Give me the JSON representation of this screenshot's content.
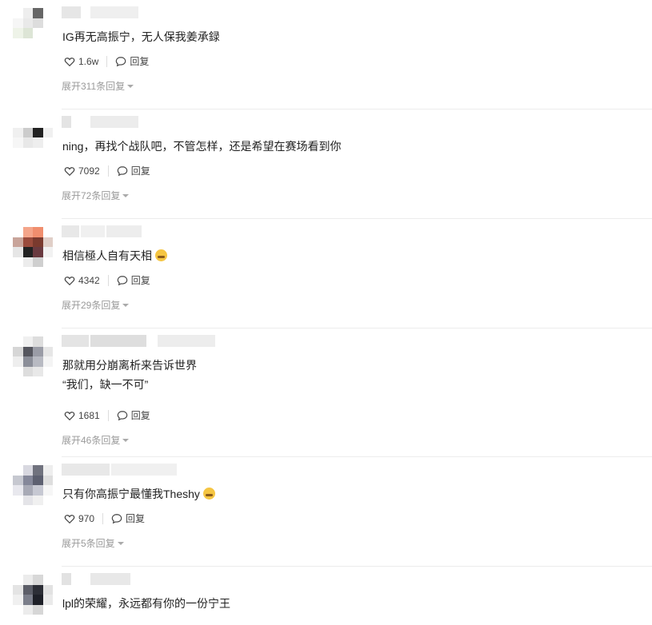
{
  "comments": [
    {
      "text": "IG再无高振宁，无人保我姜承録",
      "likes": "1.6w",
      "reply_label": "回复",
      "expand": "展开311条回复"
    },
    {
      "text": "ning，再找个战队吧，不管怎样，还是希望在赛场看到你",
      "likes": "7092",
      "reply_label": "回复",
      "expand": "展开72条回复"
    },
    {
      "text": "相信極人自有天相",
      "emoji": "crying-face-emoji",
      "likes": "4342",
      "reply_label": "回复",
      "expand": "展开29条回复"
    },
    {
      "text": "那就用分崩离析来告诉世界\n“我们，缺一不可”",
      "likes": "1681",
      "reply_label": "回复",
      "expand": "展开46条回复"
    },
    {
      "text": "只有你高振宁最懂我Theshy",
      "emoji": "sunglasses-face-emoji",
      "likes": "970",
      "reply_label": "回复",
      "expand": "展开5条回复"
    },
    {
      "text": "lpl的荣耀，永远都有你的一份宁王"
    }
  ],
  "colors": {
    "muted": "#9a9a9a",
    "divider": "#ececec",
    "text": "#222222"
  }
}
